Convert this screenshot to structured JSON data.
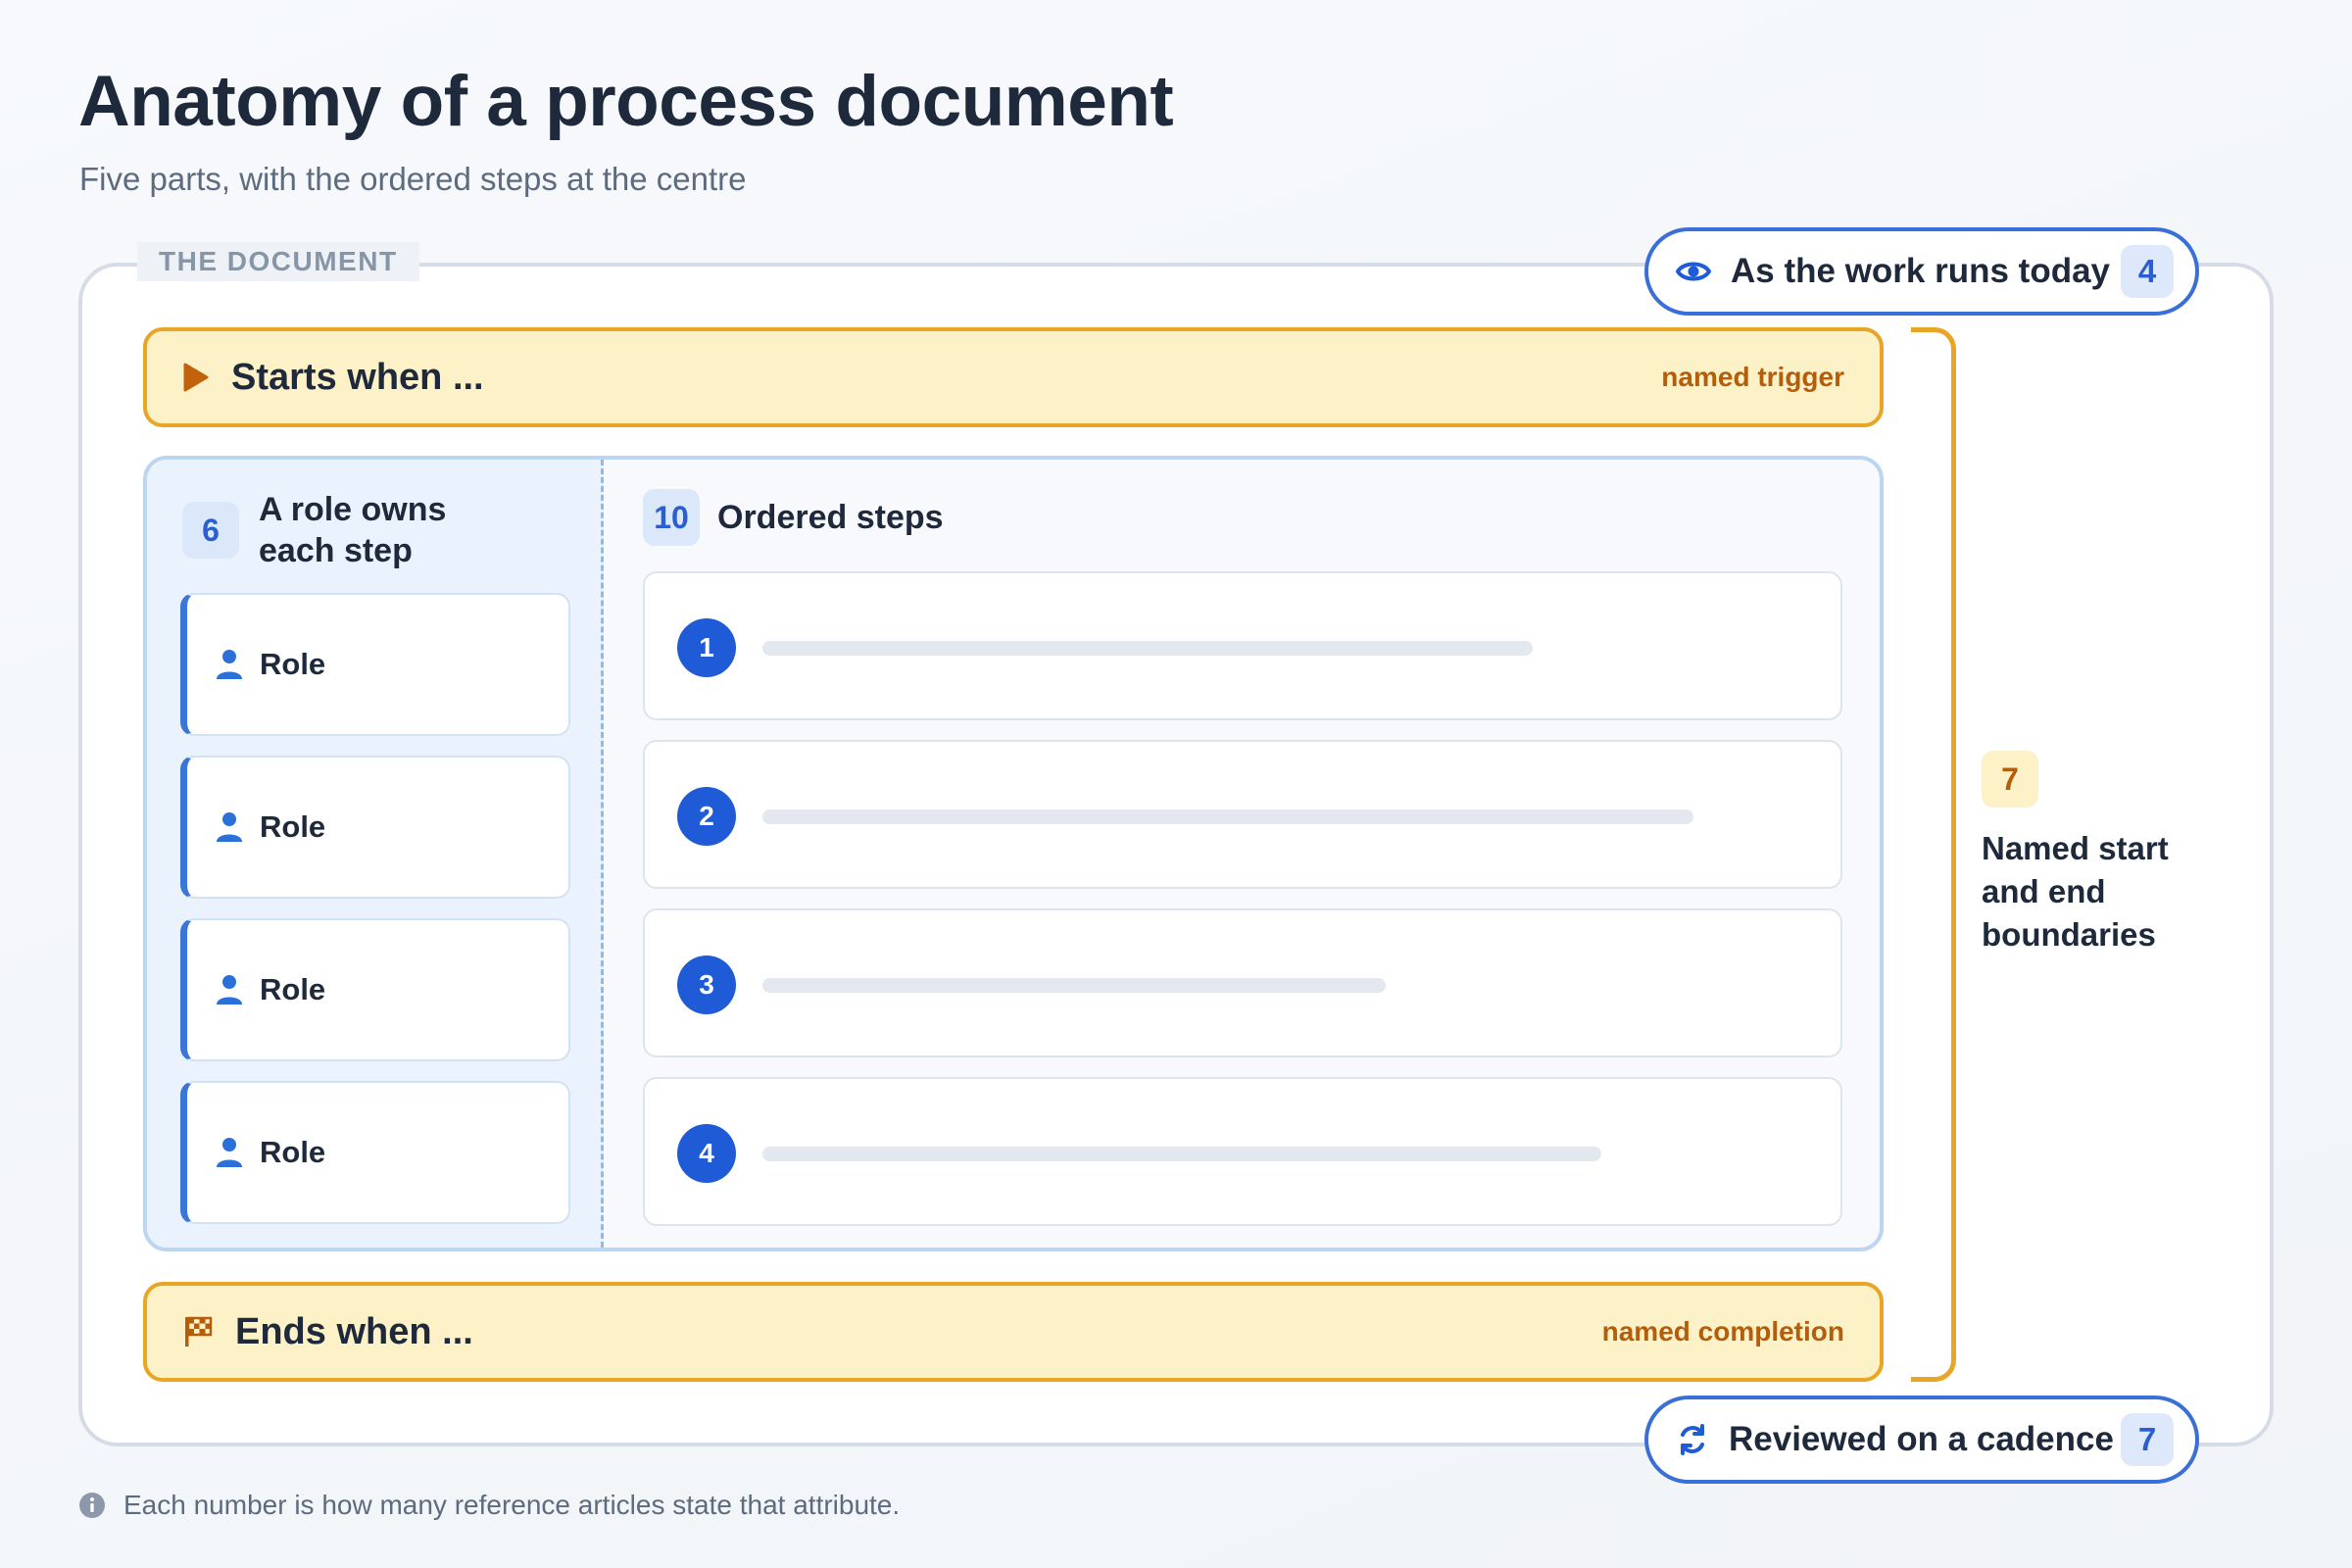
{
  "header": {
    "title": "Anatomy of a process document",
    "subtitle": "Five parts, with the ordered steps at the centre"
  },
  "document": {
    "tag": "THE DOCUMENT"
  },
  "callouts": {
    "current_state": {
      "label": "As the work runs today",
      "count": "4",
      "icon": "eye-icon"
    },
    "review": {
      "label": "Reviewed on a cadence",
      "count": "7",
      "icon": "refresh-icon"
    }
  },
  "trigger": {
    "title": "Starts when ...",
    "note": "named trigger",
    "icon": "play-icon"
  },
  "completion": {
    "title": "Ends when ...",
    "note": "named completion",
    "icon": "checkered-flag-icon"
  },
  "roles": {
    "count": "6",
    "label": "A role owns each step",
    "items": [
      {
        "label": "Role",
        "icon": "person-icon"
      },
      {
        "label": "Role",
        "icon": "person-icon"
      },
      {
        "label": "Role",
        "icon": "person-icon"
      },
      {
        "label": "Role",
        "icon": "person-icon"
      }
    ]
  },
  "steps": {
    "count": "10",
    "label": "Ordered steps",
    "items": [
      {
        "number": "1"
      },
      {
        "number": "2"
      },
      {
        "number": "3"
      },
      {
        "number": "4"
      }
    ]
  },
  "boundaries": {
    "count": "7",
    "label": "Named start and end boundaries"
  },
  "footnote": {
    "text": "Each number is how many reference articles state that attribute.",
    "icon": "info-icon"
  },
  "colors": {
    "accent_blue": "#1f5bd6",
    "boundary_orange": "#e8a526",
    "boundary_fill": "#fdf1c8",
    "note_text": "#b45d0a"
  }
}
